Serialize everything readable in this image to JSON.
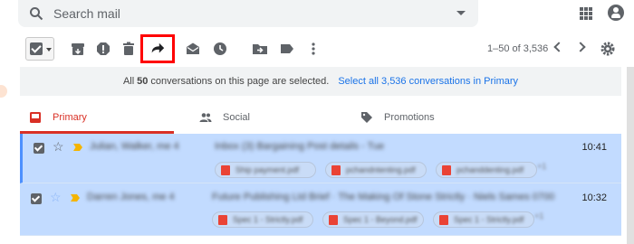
{
  "search": {
    "placeholder": "Search mail",
    "icons": [
      "search-icon",
      "chevron-down-icon",
      "apps-icon",
      "account-icon"
    ]
  },
  "toolbar": {
    "icons": [
      "checkbox-icon",
      "archive-icon",
      "report-spam-icon",
      "delete-icon",
      "forward-icon",
      "mark-read-icon",
      "snooze-icon",
      "move-to-icon",
      "label-icon",
      "more-vert-icon"
    ],
    "highlighted": "forward-icon",
    "pagination": "1–50 of 3,536"
  },
  "banner": {
    "prefix": "All",
    "count": "50",
    "suffix": "conversations on this page are selected.",
    "link": "Select all 3,536 conversations in Primary"
  },
  "tabs": [
    {
      "label": "Primary",
      "icon": "inbox-icon",
      "active": true
    },
    {
      "label": "Social",
      "icon": "people-icon",
      "active": false
    },
    {
      "label": "Promotions",
      "icon": "tag-icon",
      "active": false
    }
  ],
  "messages": [
    {
      "sender": "Julian, Walker, me 4",
      "subject": "Inbox (3)  Bargaining Post details - Tue",
      "time": "10:41",
      "attachments": [
        "Ship payment.pdf",
        "pchandntenting.pdf",
        "pchanddenting.pdf"
      ],
      "more": "+1"
    },
    {
      "sender": "Darren Jones, me 4",
      "subject": "Future Publishing Ltd Brief · The Making Of Stone Strictly · Niels Sames 0700",
      "time": "10:32",
      "attachments": [
        "Spec 1 - Strictly.pdf",
        "Spec 1 - Beyond.pdf",
        "Spec 1 - Strictly.pdf"
      ],
      "more": "+1"
    }
  ],
  "colors": {
    "selected_row": "#c2dbff",
    "accent_red": "#d93025",
    "link_blue": "#1a73e8",
    "highlight_box": "#ff0000",
    "importance_marker": "#f4b400"
  }
}
